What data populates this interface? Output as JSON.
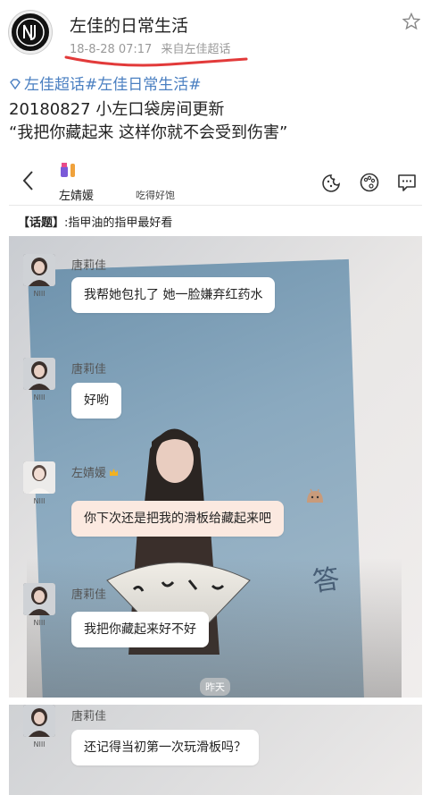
{
  "post": {
    "author": "左佳的日常生活",
    "date": "18-8-28 07:17",
    "source": "来自左佳超话",
    "tags": "左佳超话#左佳日常生活#",
    "line1": "20180827 小左口袋房间更新",
    "line2": "“我把你藏起来  这样你就不会受到伤害”"
  },
  "chat": {
    "title": "左婧媛",
    "status": "吃得好饱",
    "topic_label": "【话题】",
    "topic_text": ":指甲油的指甲最好看",
    "timestamp": "昨天",
    "messages": [
      {
        "sender": "唐莉佳",
        "sub": "NIII",
        "text": "我帮她包扎了 她一脸嫌弃红药水"
      },
      {
        "sender": "唐莉佳",
        "sub": "NIII",
        "text": "好哟"
      },
      {
        "sender": "左婧媛",
        "sub": "NIII",
        "text": "你下次还是把我的滑板给藏起来吧"
      },
      {
        "sender": "唐莉佳",
        "sub": "NIII",
        "text": "我把你藏起来好不好"
      },
      {
        "sender": "唐莉佳",
        "sub": "NIII",
        "text": "还记得当初第一次玩滑板吗？"
      }
    ]
  },
  "icons": {
    "star": "star-icon",
    "back": "back-chevron-icon",
    "gift": "gift-icon",
    "header_right": [
      "cookie-icon",
      "palette-icon",
      "comment-icon"
    ]
  },
  "colors": {
    "tag_blue": "#4a7fc1",
    "underline_red": "#e23a3a",
    "pink_bubble": "#fbe9e0"
  }
}
